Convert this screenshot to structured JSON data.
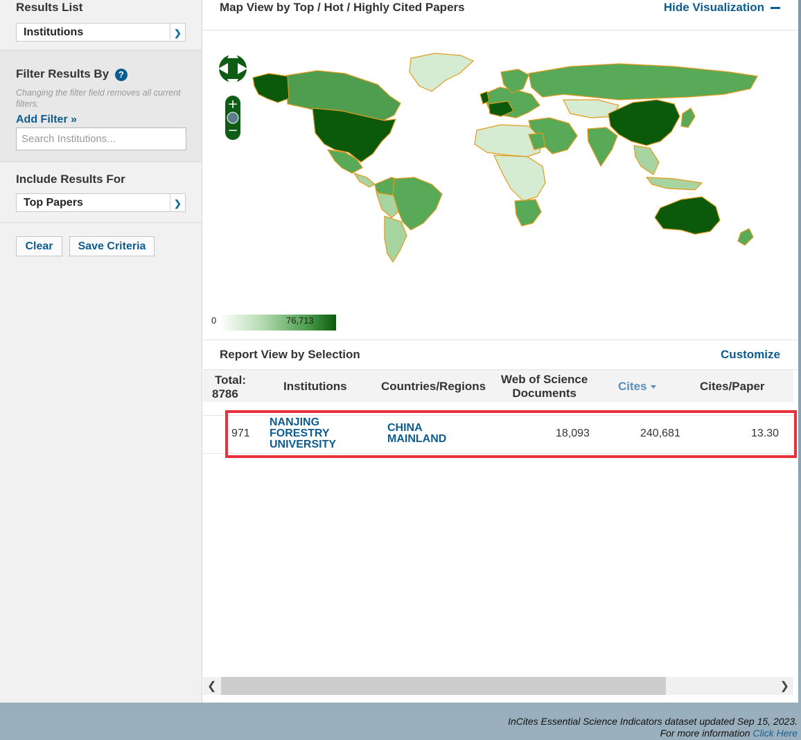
{
  "sidebar": {
    "results_list_label": "Results List",
    "results_list_value": "Institutions",
    "filter_label": "Filter Results By",
    "filter_help": "?",
    "filter_hint": "Changing the filter field removes all current filters.",
    "add_filter": "Add Filter »",
    "search_placeholder": "Search Institutions...",
    "include_label": "Include Results For",
    "include_value": "Top Papers",
    "clear_button": "Clear",
    "save_button": "Save Criteria"
  },
  "map": {
    "title": "Map View by Top / Hot / Highly Cited Papers",
    "hide_visualization": "Hide Visualization",
    "legend_min": "0",
    "legend_max": "76,713",
    "colors": {
      "dark": "#0b5a0b",
      "mid": "#58aa59",
      "light": "#d6ecd2",
      "border": "#e39a19"
    }
  },
  "report": {
    "title": "Report View by Selection",
    "customize": "Customize",
    "columns": {
      "total_label": "Total:",
      "total_value": "8786",
      "institutions": "Institutions",
      "countries": "Countries/Regions",
      "wos_docs_line1": "Web of Science",
      "wos_docs_line2": "Documents",
      "cites": "Cites",
      "cites_per_paper": "Cites/Paper"
    },
    "rows": [
      {
        "rank": "971",
        "institution_line1": "NANJING",
        "institution_line2": "FORESTRY",
        "institution_line3": "UNIVERSITY",
        "country_line1": "CHINA",
        "country_line2": "MAINLAND",
        "documents": "18,093",
        "cites": "240,681",
        "cites_per_paper": "13.30"
      }
    ]
  },
  "footer": {
    "line1": "InCites Essential Science Indicators dataset updated Sep 15, 2023.",
    "line2_text": "For more information",
    "line2_link": "Click Here"
  }
}
